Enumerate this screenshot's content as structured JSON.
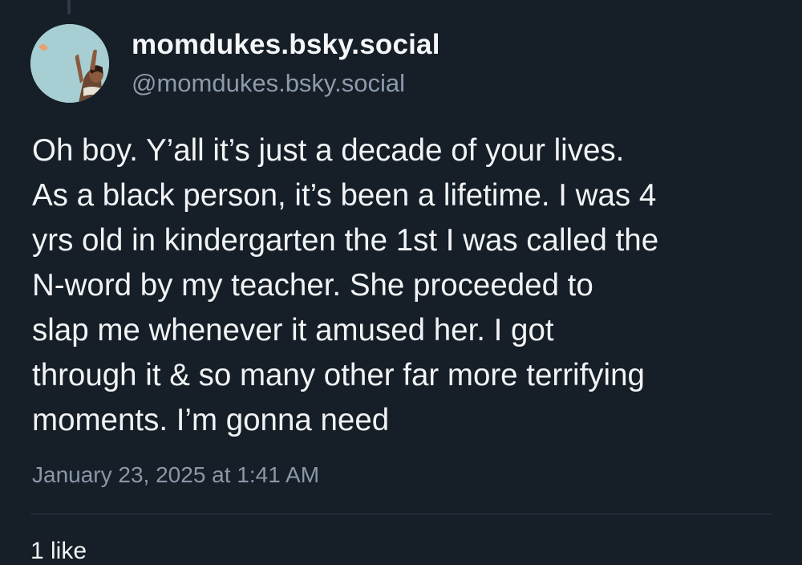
{
  "post": {
    "display_name": "momdukes.bsky.social",
    "handle": "@momdukes.bsky.social",
    "text": "Oh boy. Y’all it’s just a decade of your lives.\nAs a black person, it’s been a lifetime. I was 4\nyrs old in kindergarten the 1st I was called the\nN-word by my teacher. She proceeded to\nslap me whenever it amused her. I got\nthrough it & so many other far more terrifying\nmoments. I’m gonna need",
    "timestamp": "January 23, 2025 at 1:41 AM",
    "likes_label": "1 like"
  },
  "colors": {
    "background": "#161e27",
    "text": "#f1f3f5",
    "muted": "#8c9bab",
    "divider": "#2c3744",
    "avatar_bg": "#a7cfd3"
  },
  "icons": {
    "avatar": "avatar-illustration"
  }
}
